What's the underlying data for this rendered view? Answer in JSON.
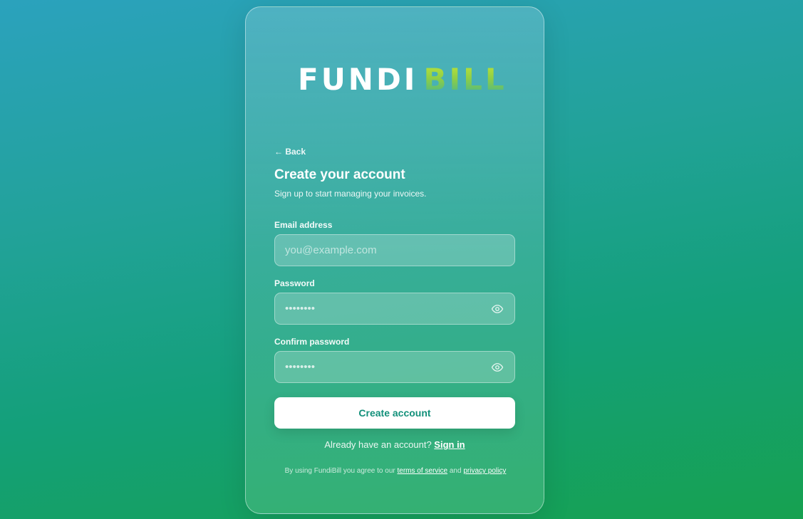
{
  "brand": {
    "name_part1": "FUNDI",
    "name_part2": "BILL"
  },
  "nav": {
    "back_label": "← Back"
  },
  "form": {
    "title": "Create your account",
    "subtitle": "Sign up to start managing your invoices.",
    "email": {
      "label": "Email address",
      "placeholder": "you@example.com",
      "value": ""
    },
    "password": {
      "label": "Password",
      "masked_value": "••••••••"
    },
    "confirm_password": {
      "label": "Confirm password",
      "masked_value": "••••••••"
    },
    "submit_label": "Create account"
  },
  "signin": {
    "prompt": "Already have an account?",
    "link_label": "Sign in"
  },
  "terms": {
    "prefix": "By using FundiBill you agree to our",
    "tos_label": "terms of service",
    "and": "and",
    "privacy_label": "privacy policy"
  },
  "icons": {
    "password_toggle": "eye-icon",
    "confirm_toggle": "eye-icon"
  },
  "colors": {
    "brand_white": "#ffffff",
    "brand_accent": "#a9d63a",
    "button_text": "#12907a",
    "bg_top": "#2ba2bd",
    "bg_bottom": "#16a150"
  }
}
